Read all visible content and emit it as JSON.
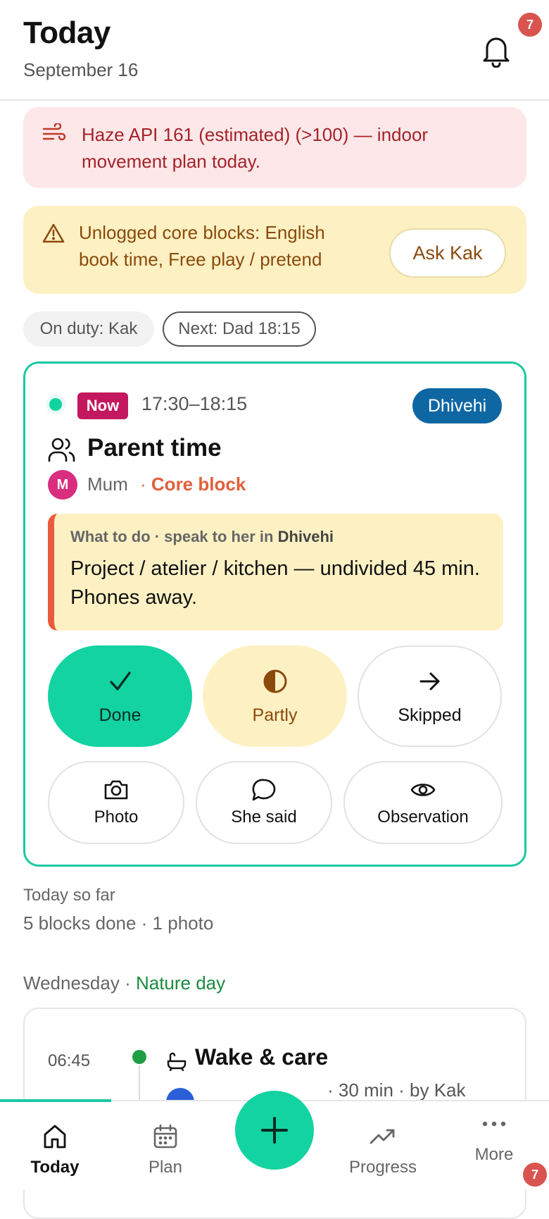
{
  "header": {
    "title": "Today",
    "date": "September 16",
    "notification_count": "7"
  },
  "alerts": {
    "haze": {
      "text": "Haze API 161 (estimated) (>100) — indoor movement plan today.",
      "icon": "wind-icon",
      "color": "#a3232a",
      "background": "#fde7e8"
    },
    "core_blocks": {
      "text": "Unlogged core blocks: English book time, Free play / pretend",
      "icon": "warning-triangle-icon",
      "button_label": "Ask Kak",
      "color": "#8a4a0c",
      "background": "#fdf0c2"
    }
  },
  "chips": {
    "on_duty": "On duty: Kak",
    "next": "Next: Dad 18:15"
  },
  "current_block": {
    "status_badge": "Now",
    "time_range": "17:30–18:15",
    "language": "Dhivehi",
    "title": "Parent time",
    "title_icon": "people-icon",
    "avatar_initial": "M",
    "person": "Mum",
    "separator": "·",
    "tag": "Core block",
    "what_to_do": {
      "label_prefix": "What to do · speak to her in ",
      "label_language": "Dhivehi",
      "text": "Project / atelier / kitchen — undivided 45 min. Phones away."
    },
    "actions": {
      "done": {
        "label": "Done",
        "icon": "check-icon"
      },
      "partly": {
        "label": "Partly",
        "icon": "half-circle-icon"
      },
      "skipped": {
        "label": "Skipped",
        "icon": "arrow-right-icon"
      },
      "photo": {
        "label": "Photo",
        "icon": "camera-icon"
      },
      "she_said": {
        "label": "She said",
        "icon": "speech-bubble-icon"
      },
      "observation": {
        "label": "Observation",
        "icon": "eye-icon"
      }
    },
    "accent_color": "#1ac9a0"
  },
  "summary": {
    "label": "Today so far",
    "value": "5 blocks done · 1 photo"
  },
  "day": {
    "weekday": "Wednesday",
    "separator": " · ",
    "theme": "Nature day"
  },
  "timeline": [
    {
      "time": "06:45",
      "title": "Wake & care",
      "icon": "bath-icon",
      "meta": "· 30 min · by Kak"
    }
  ],
  "bottom_nav": {
    "today": {
      "label": "Today",
      "icon": "home-icon"
    },
    "plan": {
      "label": "Plan",
      "icon": "calendar-icon"
    },
    "add": {
      "icon": "plus-icon"
    },
    "progress": {
      "label": "Progress",
      "icon": "trend-icon"
    },
    "more": {
      "label": "More",
      "icon": "ellipsis-icon",
      "badge": "7"
    }
  }
}
